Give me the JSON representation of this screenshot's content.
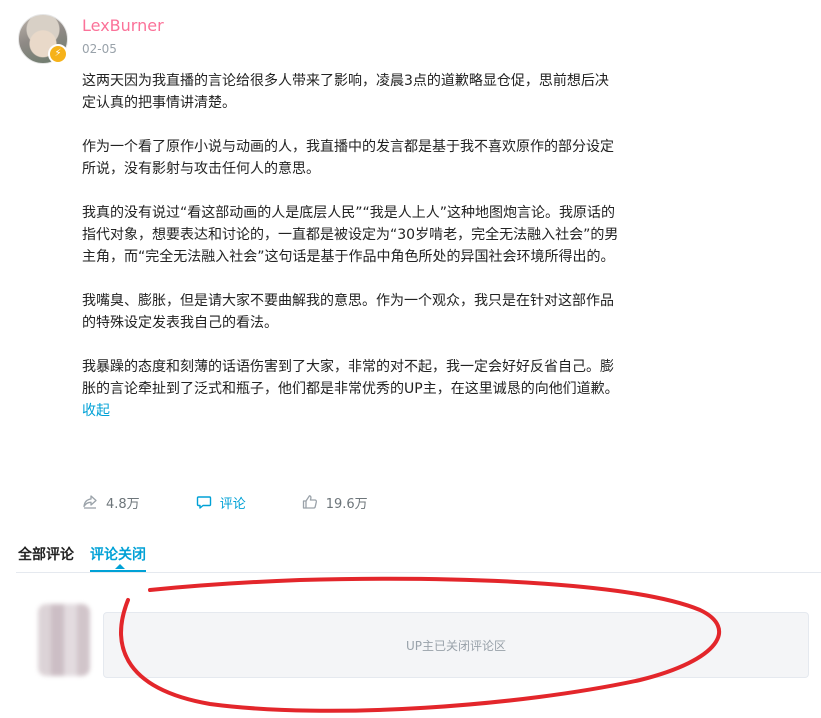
{
  "post": {
    "username": "LexBurner",
    "date": "02-05",
    "paragraphs": [
      "这两天因为我直播的言论给很多人带来了影响，凌晨3点的道歉略显仓促，思前想后决定认真的把事情讲清楚。",
      "作为一个看了原作小说与动画的人，我直播中的发言都是基于我不喜欢原作的部分设定所说，没有影射与攻击任何人的意思。",
      "我真的没有说过“看这部动画的人是底层人民”“我是人上人”这种地图炮言论。我原话的指代对象，想要表达和讨论的，一直都是被设定为“30岁啃老，完全无法融入社会”的男主角，而“完全无法融入社会”这句话是基于作品中角色所处的异国社会环境所得出的。",
      "我嘴臭、膨胀，但是请大家不要曲解我的意思。作为一个观众，我只是在针对这部作品的特殊设定发表我自己的看法。",
      "我暴躁的态度和刻薄的话语伤害到了大家，非常的对不起，我一定会好好反省自己。膨胀的言论牵扯到了泛式和瓶子，他们都是非常优秀的UP主，在这里诚恳的向他们道歉。"
    ],
    "collapse_label": "收起"
  },
  "actions": {
    "share_count": "4.8万",
    "comment_label": "评论",
    "like_count": "19.6万"
  },
  "tabs": {
    "all": "全部评论",
    "closed": "评论关闭"
  },
  "comments_closed_text": "UP主已关闭评论区",
  "colors": {
    "username": "#fb7299",
    "accent": "#00a1d6",
    "annotation": "#e3262b"
  },
  "icons": [
    "share-icon",
    "comment-icon",
    "like-icon",
    "vip-badge-icon"
  ]
}
